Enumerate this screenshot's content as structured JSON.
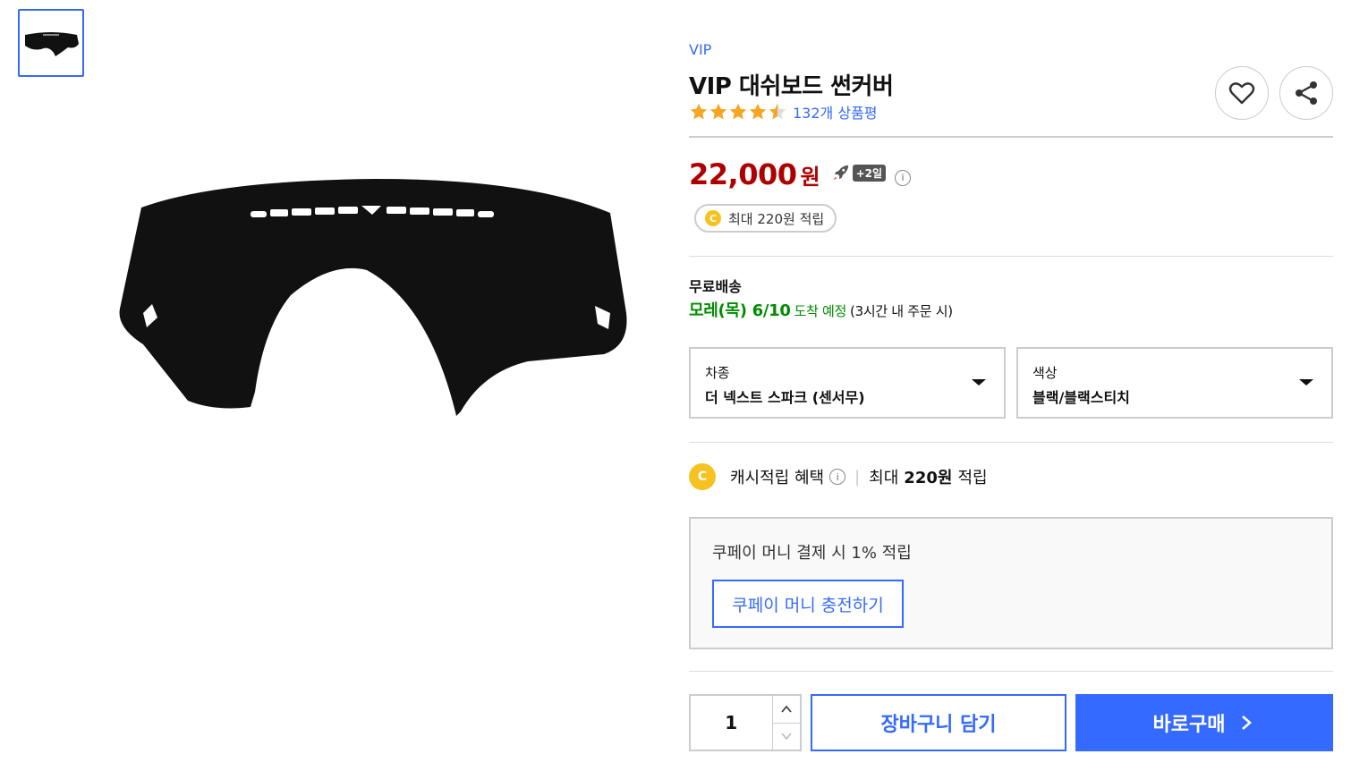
{
  "product": {
    "brand": "VIP",
    "title": "VIP 대쉬보드 썬커버",
    "rating": 4.5,
    "review_count": "132개 상품평",
    "price": "22,000",
    "currency": "원",
    "delivery_badge": "+2일",
    "cash_pill": "최대 220원 적립"
  },
  "shipping": {
    "label": "무료배송",
    "date": "모레(목) 6/10",
    "arrive": "도착 예정",
    "note": "(3시간 내 주문 시)"
  },
  "options": [
    {
      "label": "차종",
      "value": "더 넥스트 스파크 (센서무)"
    },
    {
      "label": "색상",
      "value": "블랙/블랙스티치"
    }
  ],
  "cash_benefit": {
    "coin": "C",
    "title": "캐시적립 혜택",
    "max_prefix": "최대",
    "max_amount": "220원",
    "max_suffix": "적립"
  },
  "coupay": {
    "text": "쿠페이 머니 결제 시 1% 적립",
    "button": "쿠페이 머니 충전하기"
  },
  "purchase": {
    "quantity": "1",
    "cart_label": "장바구니 담기",
    "buy_label": "바로구매"
  },
  "colors": {
    "accent": "#346aff",
    "price": "#ae0000",
    "shipping": "#008c00",
    "star": "#f5a623"
  },
  "icons": {
    "favorite": "heart-icon",
    "share": "share-icon",
    "rocket": "rocket-icon",
    "info": "info-icon"
  }
}
